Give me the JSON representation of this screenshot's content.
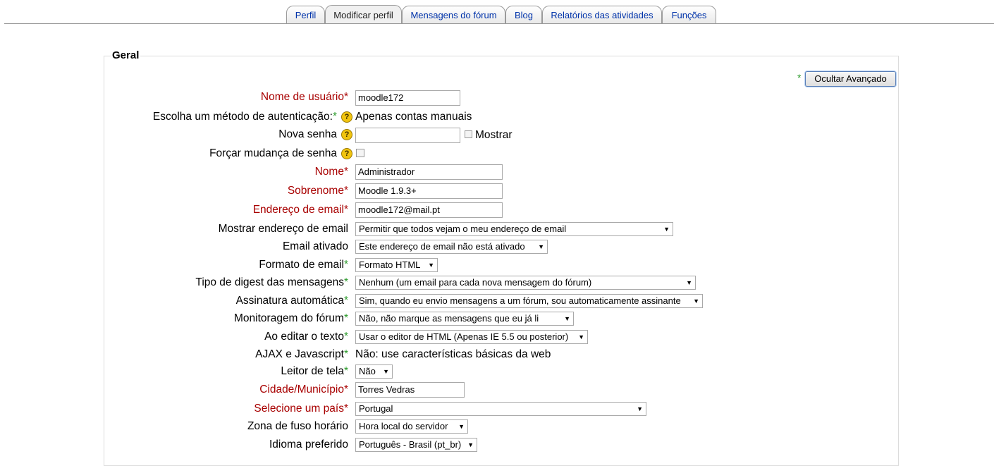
{
  "tabs": [
    "Perfil",
    "Modificar perfil",
    "Mensagens do fórum",
    "Blog",
    "Relatórios das atividades",
    "Funções"
  ],
  "section": {
    "legend": "Geral",
    "advanced_button": "Ocultar Avançado",
    "advanced_star": "*"
  },
  "fields": {
    "username": {
      "label": "Nome de usuário",
      "value": "moodle172"
    },
    "auth": {
      "label": "Escolha um método de autenticação:",
      "value": "Apenas contas manuais"
    },
    "password": {
      "label": "Nova senha",
      "value": "",
      "show_label": "Mostrar"
    },
    "force_change": {
      "label": "Forçar mudança de senha"
    },
    "firstname": {
      "label": "Nome",
      "value": "Administrador"
    },
    "lastname": {
      "label": "Sobrenome",
      "value": "Moodle 1.9.3+"
    },
    "email": {
      "label": "Endereço de email",
      "value": "moodle172@mail.pt"
    },
    "maildisplay": {
      "label": "Mostrar endereço de email",
      "value": "Permitir que todos vejam o meu endereço de email"
    },
    "emailstop": {
      "label": "Email ativado",
      "value": "Este endereço de email não está ativado"
    },
    "mailformat": {
      "label": "Formato de email",
      "value": "Formato HTML"
    },
    "maildigest": {
      "label": "Tipo de digest das mensagens",
      "value": "Nenhum (um email para cada nova mensagem do fórum)"
    },
    "autosubscribe": {
      "label": "Assinatura automática",
      "value": "Sim, quando eu envio mensagens a um fórum, sou automaticamente assinante"
    },
    "trackforums": {
      "label": "Monitoragem do fórum",
      "value": "Não, não marque as mensagens que eu já li"
    },
    "htmleditor": {
      "label": "Ao editar o texto",
      "value": "Usar o editor de HTML (Apenas IE 5.5 ou posterior)"
    },
    "ajax": {
      "label": "AJAX e Javascript",
      "value": "Não: use características básicas da web"
    },
    "screenreader": {
      "label": "Leitor de tela",
      "value": "Não"
    },
    "city": {
      "label": "Cidade/Município",
      "value": "Torres Vedras"
    },
    "country": {
      "label": "Selecione um país",
      "value": "Portugal"
    },
    "timezone": {
      "label": "Zona de fuso horário",
      "value": "Hora local do servidor"
    },
    "lang": {
      "label": "Idioma preferido",
      "value": "Português - Brasil (pt_br)"
    }
  },
  "symbols": {
    "required": "*",
    "help": "?",
    "dropdown": "▼"
  },
  "colors": {
    "required": "#a80000",
    "advanced": "#2a9a2a",
    "link": "#0033aa"
  }
}
